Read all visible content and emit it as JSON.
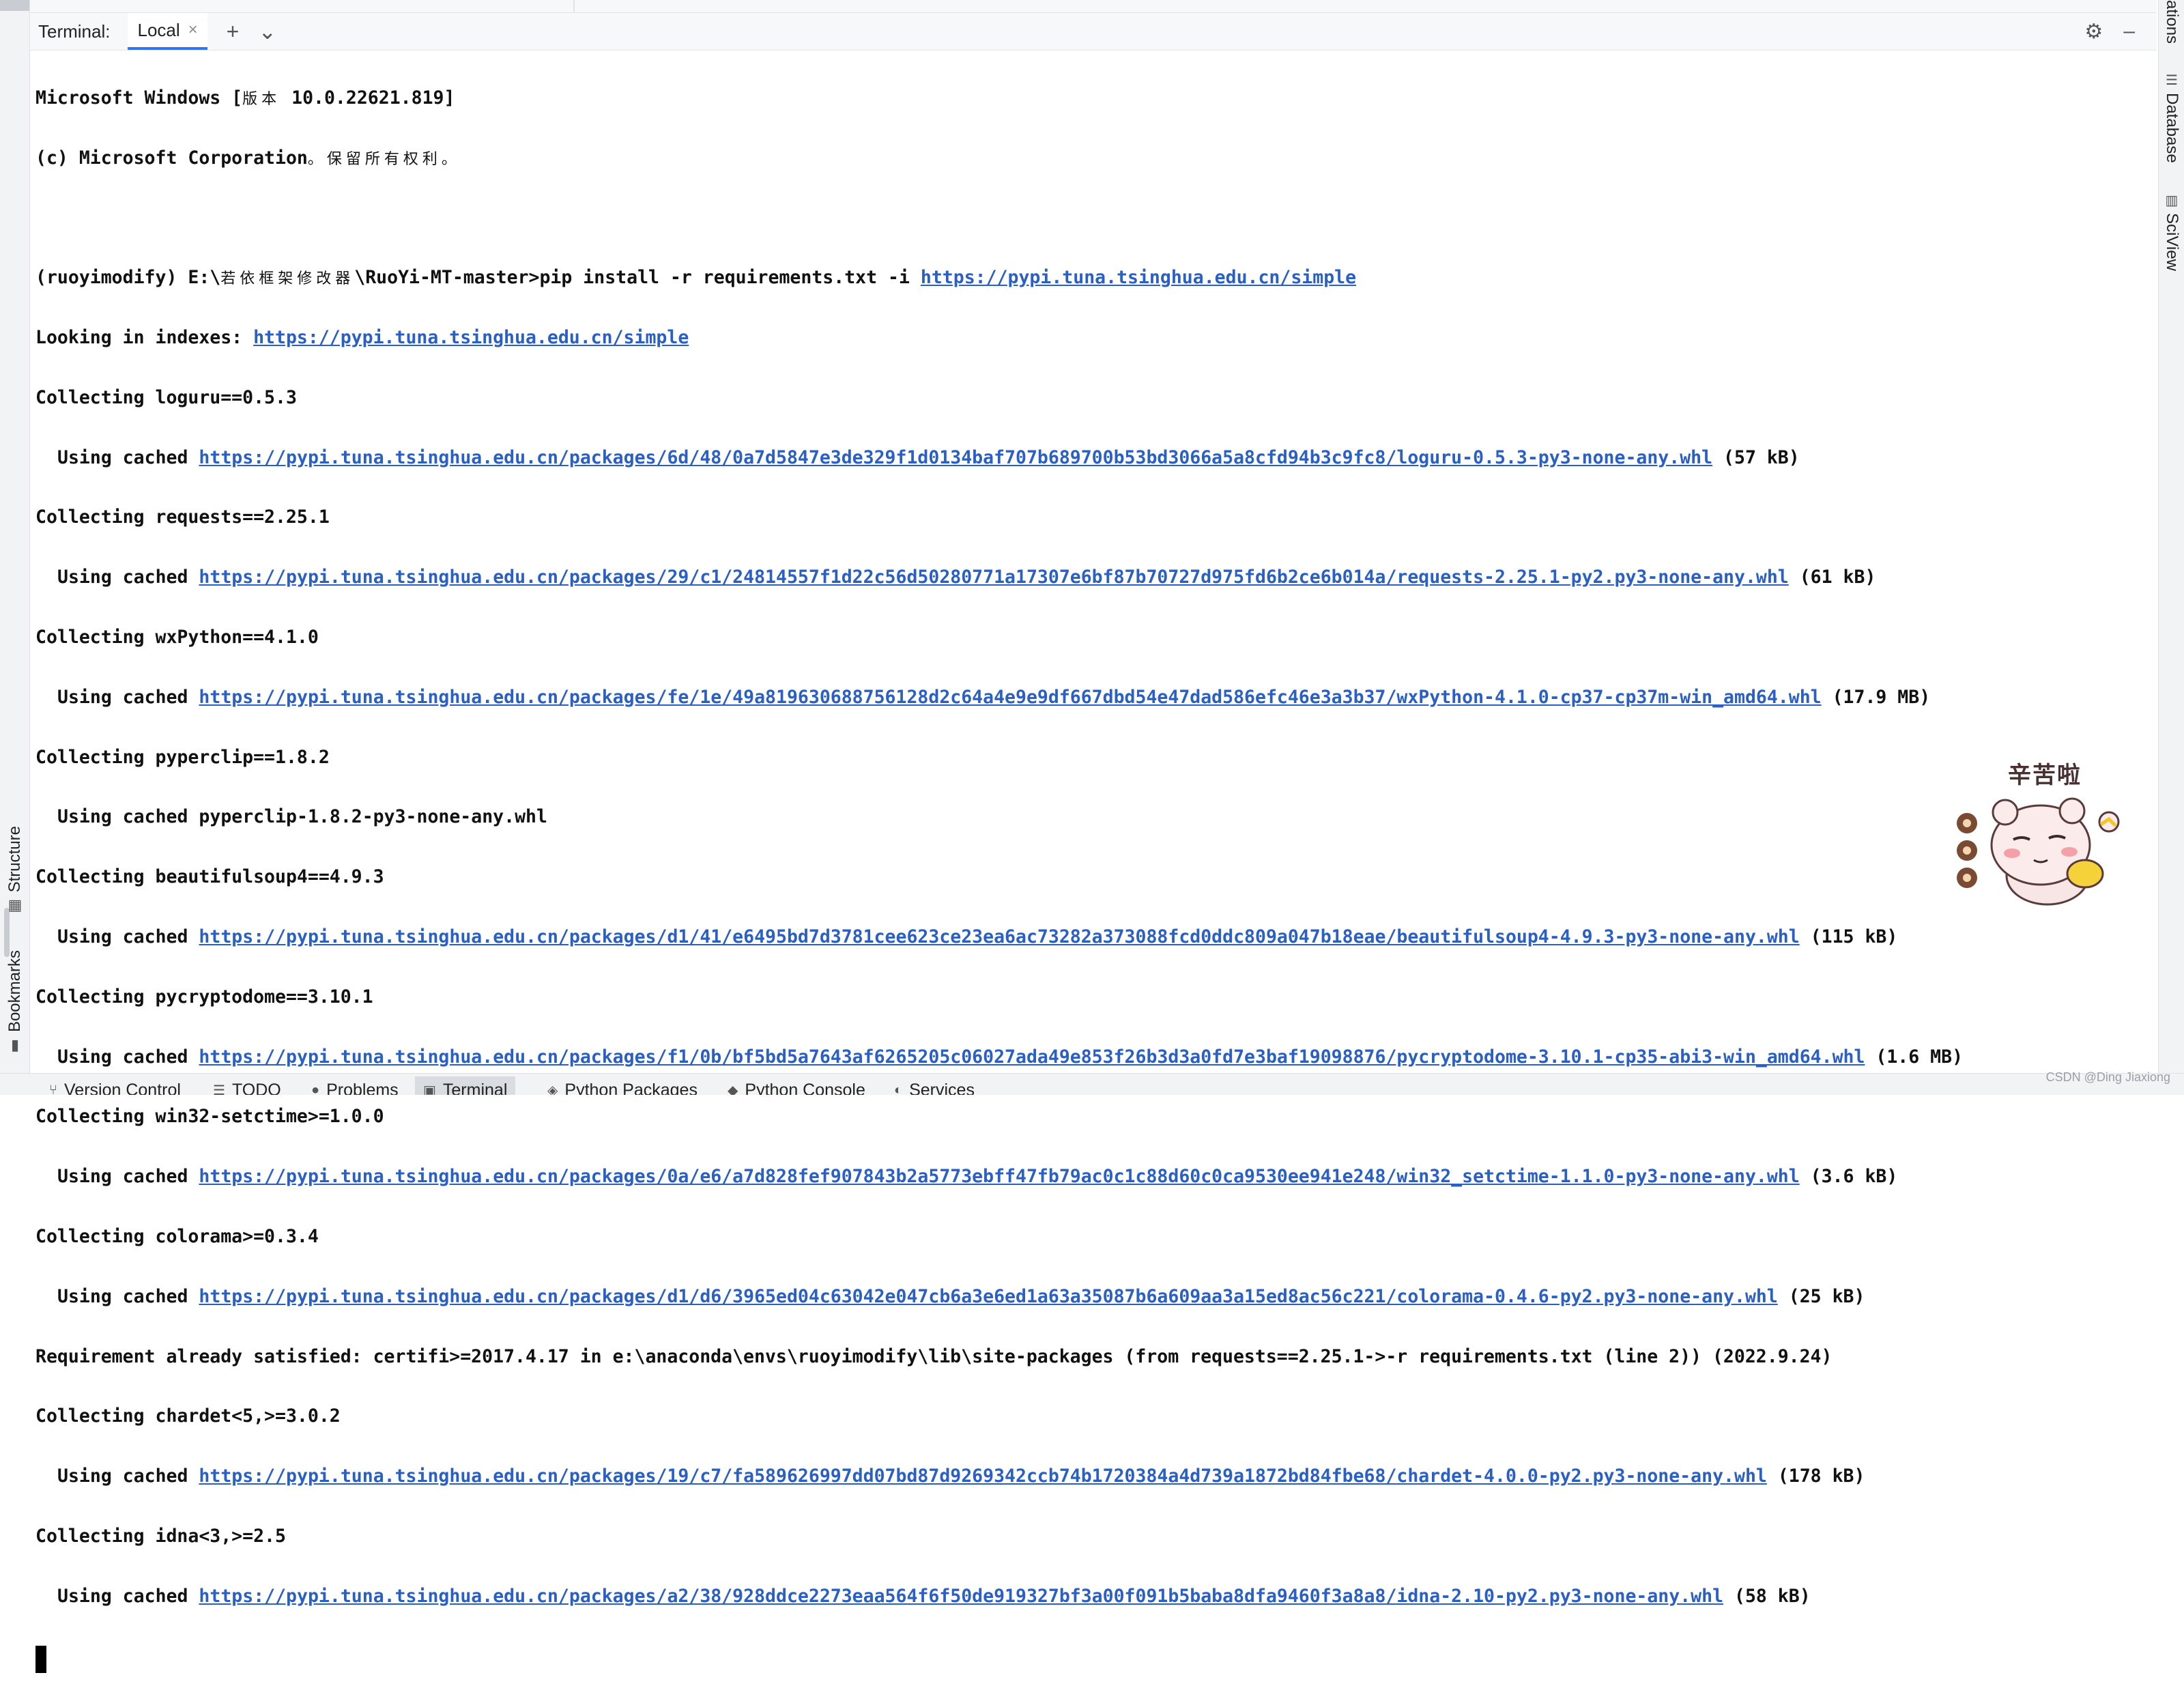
{
  "terminal": {
    "title": "Terminal:",
    "tab": "Local",
    "tab_close": "×",
    "new_tab": "+",
    "dropdown": "⌄",
    "settings_icon": "⚙",
    "minimize_icon": "–"
  },
  "left_tools": {
    "structure": "Structure",
    "bookmarks": "Bookmarks"
  },
  "right_tools": {
    "notifications": "ations",
    "database": "Database",
    "sciview": "SciView"
  },
  "lines": {
    "l0a": "Microsoft Windows [",
    "l0b": "版本",
    "l0c": " 10.0.22621.819]",
    "l1a": "(c) Microsoft Corporation",
    "l1b": "。保留所有权利。",
    "l3a": "(ruoyimodify) E:\\",
    "l3b": "若依框架修改器",
    "l3c": "\\RuoYi-MT-master>pip install -r requirements.txt -i ",
    "l3link": "https://pypi.tuna.tsinghua.edu.cn/simple",
    "l4a": "Looking in indexes: ",
    "l4link": "https://pypi.tuna.tsinghua.edu.cn/simple",
    "l5": "Collecting loguru==0.5.3",
    "l6a": "Using cached ",
    "l6link": "https://pypi.tuna.tsinghua.edu.cn/packages/6d/48/0a7d5847e3de329f1d0134baf707b689700b53bd3066a5a8cfd94b3c9fc8/loguru-0.5.3-py3-none-any.whl",
    "l6b": " (57 kB)",
    "l7": "Collecting requests==2.25.1",
    "l8a": "Using cached ",
    "l8link": "https://pypi.tuna.tsinghua.edu.cn/packages/29/c1/24814557f1d22c56d50280771a17307e6bf87b70727d975fd6b2ce6b014a/requests-2.25.1-py2.py3-none-any.whl",
    "l8b": " (61 kB)",
    "l9": "Collecting wxPython==4.1.0",
    "l10a": "Using cached ",
    "l10link": "https://pypi.tuna.tsinghua.edu.cn/packages/fe/1e/49a819630688756128d2c64a4e9e9df667dbd54e47dad586efc46e3a3b37/wxPython-4.1.0-cp37-cp37m-win_amd64.whl",
    "l10b": " (17.9 MB)",
    "l11": "Collecting pyperclip==1.8.2",
    "l12": "Using cached pyperclip-1.8.2-py3-none-any.whl",
    "l13": "Collecting beautifulsoup4==4.9.3",
    "l14a": "Using cached ",
    "l14link": "https://pypi.tuna.tsinghua.edu.cn/packages/d1/41/e6495bd7d3781cee623ce23ea6ac73282a373088fcd0ddc809a047b18eae/beautifulsoup4-4.9.3-py3-none-any.whl",
    "l14b": " (115 kB)",
    "l15": "Collecting pycryptodome==3.10.1",
    "l16a": "Using cached ",
    "l16link": "https://pypi.tuna.tsinghua.edu.cn/packages/f1/0b/bf5bd5a7643af6265205c06027ada49e853f26b3d3a0fd7e3baf19098876/pycryptodome-3.10.1-cp35-abi3-win_amd64.whl",
    "l16b": " (1.6 MB)",
    "l17": "Collecting win32-setctime>=1.0.0",
    "l18a": "Using cached ",
    "l18link": "https://pypi.tuna.tsinghua.edu.cn/packages/0a/e6/a7d828fef907843b2a5773ebff47fb79ac0c1c88d60c0ca9530ee941e248/win32_setctime-1.1.0-py3-none-any.whl",
    "l18b": " (3.6 kB)",
    "l19": "Collecting colorama>=0.3.4",
    "l20a": "Using cached ",
    "l20link": "https://pypi.tuna.tsinghua.edu.cn/packages/d1/d6/3965ed04c63042e047cb6a3e6ed1a63a35087b6a609aa3a15ed8ac56c221/colorama-0.4.6-py2.py3-none-any.whl",
    "l20b": " (25 kB)",
    "l21": "Requirement already satisfied: certifi>=2017.4.17 in e:\\anaconda\\envs\\ruoyimodify\\lib\\site-packages (from requests==2.25.1->-r requirements.txt (line 2)) (2022.9.24)",
    "l22": "Collecting chardet<5,>=3.0.2",
    "l23a": "Using cached ",
    "l23link": "https://pypi.tuna.tsinghua.edu.cn/packages/19/c7/fa589626997dd07bd87d9269342ccb74b1720384a4d739a1872bd84fbe68/chardet-4.0.0-py2.py3-none-any.whl",
    "l23b": " (178 kB)",
    "l24": "Collecting idna<3,>=2.5",
    "l25a": "Using cached ",
    "l25link": "https://pypi.tuna.tsinghua.edu.cn/packages/a2/38/928ddce2273eaa564f6f50de919327bf3a00f091b5baba8dfa9460f3a8a8/idna-2.10-py2.py3-none-any.whl",
    "l25b": " (58 kB)"
  },
  "sticker_text": "辛苦啦",
  "bottom_tabs": {
    "version_control": "Version Control",
    "todo": "TODO",
    "problems": "Problems",
    "terminal": "Terminal",
    "python_packages": "Python Packages",
    "python_console": "Python Console",
    "services": "Services"
  },
  "watermark": "CSDN @Ding Jiaxiong",
  "colors": {
    "link": "#2a5fc4",
    "tab_underline": "#3574f0"
  }
}
